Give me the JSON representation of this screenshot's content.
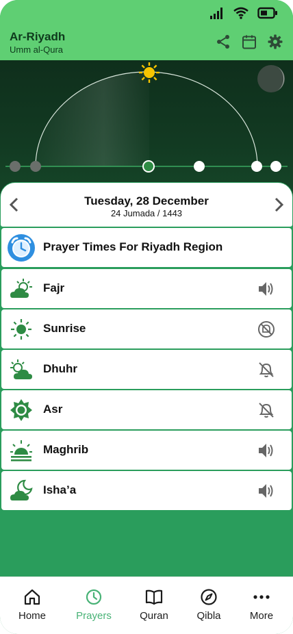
{
  "app": {
    "city": "Ar-Riyadh",
    "calc_method": "Umm al-Qura"
  },
  "colors": {
    "accent": "#2a9d5c",
    "header": "#5fcf73",
    "sky": "#123a22",
    "sun": "#f7c400",
    "icon_green": "#2e8b44"
  },
  "header_icons": [
    "share-icon",
    "calendar-icon",
    "gear-icon"
  ],
  "date": {
    "gregorian": "Tuesday, 28 December",
    "hijri": "24 Jumada / 1443"
  },
  "region_row": {
    "label": "Prayer Times For Riyadh Region",
    "icon": "alarm-clock-icon"
  },
  "prayers": [
    {
      "name": "Fajr",
      "icon": "cloud-sun-icon",
      "alert": "speaker-icon"
    },
    {
      "name": "Sunrise",
      "icon": "sun-icon",
      "alert": "bell-off-circle-icon"
    },
    {
      "name": "Dhuhr",
      "icon": "cloud-sun-icon",
      "alert": "bell-off-icon"
    },
    {
      "name": "Asr",
      "icon": "sun-badge-icon",
      "alert": "bell-off-icon"
    },
    {
      "name": "Maghrib",
      "icon": "sunset-icon",
      "alert": "speaker-icon"
    },
    {
      "name": "Isha’a",
      "icon": "cloud-moon-icon",
      "alert": "speaker-icon"
    }
  ],
  "nav": {
    "items": [
      {
        "label": "Home",
        "icon": "home-icon"
      },
      {
        "label": "Prayers",
        "icon": "clock-icon"
      },
      {
        "label": "Quran",
        "icon": "book-icon"
      },
      {
        "label": "Qibla",
        "icon": "compass-icon"
      },
      {
        "label": "More",
        "icon": "more-icon"
      }
    ],
    "active": "Prayers"
  }
}
